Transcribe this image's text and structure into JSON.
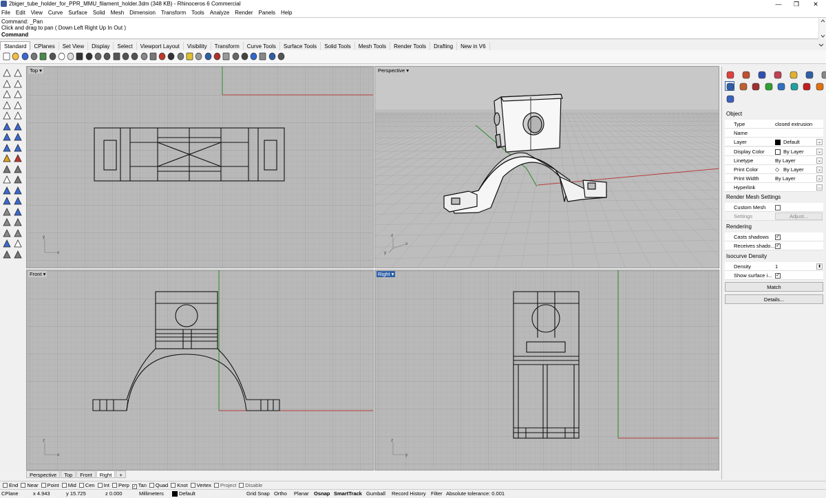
{
  "window": {
    "title": "2biger_tube_holder_for_PPR_MMU_filament_holder.3dm (348 KB) - Rhinoceros 6 Commercial",
    "minimize": "—",
    "maximize": "❐",
    "close": "✕"
  },
  "menu": [
    "File",
    "Edit",
    "View",
    "Curve",
    "Surface",
    "Solid",
    "Mesh",
    "Dimension",
    "Transform",
    "Tools",
    "Analyze",
    "Render",
    "Panels",
    "Help"
  ],
  "command": {
    "history1": "Command: _Pan",
    "history2": "Click and drag to pan ( Down  Left  Right  Up  In  Out )",
    "prompt": "Command:",
    "value": ""
  },
  "toolbar_tabs": [
    "Standard",
    "CPlanes",
    "Set View",
    "Display",
    "Select",
    "Viewport Layout",
    "Visibility",
    "Transform",
    "Curve Tools",
    "Surface Tools",
    "Solid Tools",
    "Mesh Tools",
    "Render Tools",
    "Drafting",
    "New in V6"
  ],
  "active_tab": "Standard",
  "viewports": {
    "top": "Top",
    "perspective": "Perspective",
    "front": "Front",
    "right": "Right"
  },
  "axes": {
    "x": "x",
    "y": "y",
    "z": "z"
  },
  "viewport_tabs": [
    "Perspective",
    "Top",
    "Front",
    "Right"
  ],
  "viewport_tab_add": "+",
  "panel": {
    "object_header": "Object",
    "rows": [
      {
        "k": "Type",
        "v": "closed extrusion"
      },
      {
        "k": "Name",
        "v": ""
      },
      {
        "k": "Layer",
        "v": "Default"
      },
      {
        "k": "Display Color",
        "v": "By Layer"
      },
      {
        "k": "Linetype",
        "v": "By Layer"
      },
      {
        "k": "Print Color",
        "v": "By Layer"
      },
      {
        "k": "Print Width",
        "v": "By Layer"
      },
      {
        "k": "Hyperlink",
        "v": ""
      }
    ],
    "render_mesh_header": "Render Mesh Settings",
    "custom_mesh": "Custom Mesh",
    "settings": "Settings",
    "adjust": "Adjust...",
    "rendering_header": "Rendering",
    "casts_shadows": "Casts shadows",
    "receives_shadows": "Receives shado...",
    "isocurve_header": "Isocurve Density",
    "density_label": "Density",
    "density_value": "1",
    "show_surface": "Show surface i...",
    "match": "Match",
    "details": "Details..."
  },
  "osnaps": [
    {
      "label": "End",
      "checked": false
    },
    {
      "label": "Near",
      "checked": false
    },
    {
      "label": "Point",
      "checked": false
    },
    {
      "label": "Mid",
      "checked": false
    },
    {
      "label": "Cen",
      "checked": false
    },
    {
      "label": "Int",
      "checked": false
    },
    {
      "label": "Perp",
      "checked": false
    },
    {
      "label": "Tan",
      "checked": true
    },
    {
      "label": "Quad",
      "checked": false
    },
    {
      "label": "Knot",
      "checked": false
    },
    {
      "label": "Vertex",
      "checked": false
    },
    {
      "label": "Project",
      "checked": false
    },
    {
      "label": "Disable",
      "checked": false
    }
  ],
  "status": {
    "cplane": "CPlane",
    "x": "x 4.943",
    "y": "y 15.725",
    "z": "z 0.000",
    "units": "Millimeters",
    "layer": "Default",
    "grid_snap": "Grid Snap",
    "ortho": "Ortho",
    "planar": "Planar",
    "osnap": "Osnap",
    "smarttrack": "SmartTrack",
    "gumball": "Gumball",
    "record_history": "Record History",
    "filter": "Filter",
    "tolerance": "Absolute tolerance: 0.001"
  },
  "colors": {
    "grid_bg": "#b9b9b9",
    "x_axis": "#c0392b",
    "y_axis": "#27ae60",
    "active_label": "#2f5fa8"
  }
}
